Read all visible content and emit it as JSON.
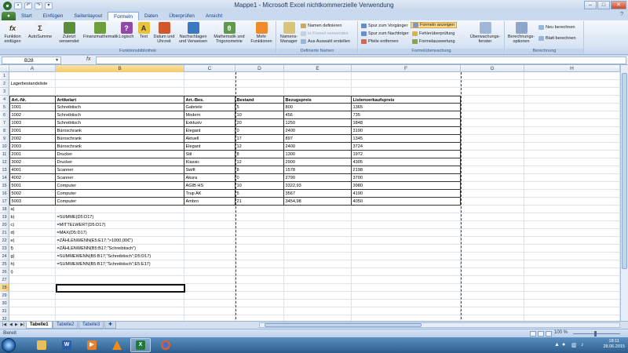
{
  "window": {
    "title": "Mappe1 - Microsoft Excel nichtkommerzielle Verwendung",
    "minimize_icon": "minimize-icon",
    "maximize_icon": "maximize-icon",
    "close_icon": "close-icon"
  },
  "quick_access": [
    "save-icon",
    "undo-icon",
    "redo-icon",
    "customize-icon"
  ],
  "ribbon_tabs": [
    "Start",
    "Einfügen",
    "Seitenlayout",
    "Formeln",
    "Daten",
    "Überprüfen",
    "Ansicht"
  ],
  "active_tab": "Formeln",
  "ribbon": {
    "groups": {
      "funktionsbibliothek": "Funktionsbibliothek",
      "definierte_namen": "Definierte Namen",
      "formelueberwachung": "Formelüberwachung",
      "berechnung": "Berechnung"
    },
    "buttons": {
      "funktion_einfuegen": "Funktion einfügen",
      "autosumme": "AutoSumme",
      "zuletzt_verwendet": "Zuletzt verwendet",
      "finanzmathematik": "Finanzmathematik",
      "logisch": "Logisch",
      "text": "Text",
      "datum_uhrzeit": "Datum und Uhrzeit",
      "nachschlagen": "Nachschlagen und Verweisen",
      "mathematik": "Mathematik und Trigonometrie",
      "mehr_funktionen": "Mehr Funktionen",
      "namens_manager": "Namens-Manager",
      "namen_definieren": "Namen definieren",
      "in_formel_verwenden": "In Formel verwenden",
      "aus_auswahl_erstellen": "Aus Auswahl erstellen",
      "spur_vorgaenger": "Spur zum Vorgänger",
      "spur_nachfolger": "Spur zum Nachfolger",
      "pfeile_entfernen": "Pfeile entfernen",
      "formeln_anzeigen": "Formeln anzeigen",
      "fehlerueberpruefung": "Fehlerüberprüfung",
      "formelauswertung": "Formelauswertung",
      "ueberwachungsfenster": "Überwachungs-fenster",
      "berechnungsoptionen": "Berechnungs-optionen",
      "neu_berechnen": "Neu berechnen",
      "blatt_berechnen": "Blatt berechnen"
    }
  },
  "formula_bar": {
    "name_box": "B28",
    "fx_label": "fx",
    "formula": ""
  },
  "columns": [
    "A",
    "B",
    "C",
    "D",
    "E",
    "F",
    "G",
    "H"
  ],
  "selected_column": "B",
  "selected_row": "28",
  "rows": [
    {
      "n": "1",
      "cells": [
        "",
        "",
        "",
        "",
        "",
        ""
      ]
    },
    {
      "n": "2",
      "cells": [
        "Lagerbestandsliste",
        "",
        "",
        "",
        "",
        ""
      ]
    },
    {
      "n": "3",
      "cells": [
        "",
        "",
        "",
        "",
        "",
        ""
      ]
    },
    {
      "n": "4",
      "cells": [
        "Art.-Nr.",
        "Artikelart",
        "Art.-Bes.",
        "Bestand",
        "Bezugspreis",
        "Listenverkaufspreis"
      ],
      "header": true
    },
    {
      "n": "5",
      "cells": [
        "1001",
        "Schreibtisch",
        "Gabriele",
        "5",
        "800",
        "1365"
      ]
    },
    {
      "n": "6",
      "cells": [
        "1002",
        "Schreibtisch",
        "Modern",
        "10",
        "456",
        "735"
      ]
    },
    {
      "n": "7",
      "cells": [
        "1003",
        "Schreibtisch",
        "Exklusiv",
        "20",
        "1250",
        "1848"
      ]
    },
    {
      "n": "8",
      "cells": [
        "2001",
        "Büroschrank",
        "Elegant",
        "0",
        "2400",
        "3190"
      ]
    },
    {
      "n": "9",
      "cells": [
        "2002",
        "Büroschrank",
        "Aktuell",
        "17",
        "897",
        "1345"
      ]
    },
    {
      "n": "10",
      "cells": [
        "2003",
        "Büroschrank",
        "Elegant",
        "12",
        "2400",
        "3724"
      ]
    },
    {
      "n": "11",
      "cells": [
        "2001",
        "Drucker",
        "Stil",
        "8",
        "1300",
        "1972"
      ]
    },
    {
      "n": "12",
      "cells": [
        "3002",
        "Drucker",
        "Klassic",
        "12",
        "2900",
        "4305"
      ]
    },
    {
      "n": "13",
      "cells": [
        "4001",
        "Scanner",
        "Swift",
        "8",
        "1578",
        "2198"
      ]
    },
    {
      "n": "14",
      "cells": [
        "4002",
        "Scanner",
        "Akura",
        "0",
        "2790",
        "3700"
      ]
    },
    {
      "n": "15",
      "cells": [
        "5001",
        "Computer",
        "AGIB HS",
        "10",
        "3322,93",
        "3980"
      ]
    },
    {
      "n": "16",
      "cells": [
        "5002",
        "Computer",
        "Trup AK",
        "5",
        "3567",
        "4190"
      ]
    },
    {
      "n": "17",
      "cells": [
        "5003",
        "Computer",
        "Ambro",
        "21",
        "3454,98",
        "4050"
      ]
    },
    {
      "n": "18",
      "cells": [
        "a)",
        "",
        "",
        "",
        "",
        ""
      ]
    },
    {
      "n": "19",
      "cells": [
        "b)",
        "=SUMME(D5:D17)",
        "",
        "",
        "",
        ""
      ]
    },
    {
      "n": "20",
      "cells": [
        "c)",
        "=MITTELWERT(D5:D17)",
        "",
        "",
        "",
        ""
      ]
    },
    {
      "n": "21",
      "cells": [
        "d)",
        "=MAX(D5:D17)",
        "",
        "",
        "",
        ""
      ]
    },
    {
      "n": "22",
      "cells": [
        "e)",
        "=ZÄHLENWENN(E5:E17;\">1000,00€\")",
        "",
        "",
        "",
        ""
      ]
    },
    {
      "n": "23",
      "cells": [
        "f)",
        "=ZÄHLENWENN(B5:B17;\"Schreibtisch\")",
        "",
        "",
        "",
        ""
      ]
    },
    {
      "n": "24",
      "cells": [
        "g)",
        "=SUMMEWENN(B5:B17;\"Schreibtisch\";D5:D17)",
        "",
        "",
        "",
        ""
      ]
    },
    {
      "n": "25",
      "cells": [
        "h)",
        "=SUMMEWENN(B5:B17;\"Schreibtisch\";E5:E17)",
        "",
        "",
        "",
        ""
      ]
    },
    {
      "n": "26",
      "cells": [
        "i)",
        "",
        "",
        "",
        "",
        ""
      ]
    },
    {
      "n": "27",
      "cells": [
        "",
        "",
        "",
        "",
        "",
        ""
      ]
    },
    {
      "n": "28",
      "cells": [
        "",
        "",
        "",
        "",
        "",
        ""
      ]
    },
    {
      "n": "29",
      "cells": [
        "",
        "",
        "",
        "",
        "",
        ""
      ]
    },
    {
      "n": "30",
      "cells": [
        "",
        "",
        "",
        "",
        "",
        ""
      ]
    },
    {
      "n": "31",
      "cells": [
        "",
        "",
        "",
        "",
        "",
        ""
      ]
    },
    {
      "n": "32",
      "cells": [
        "",
        "",
        "",
        "",
        "",
        ""
      ]
    }
  ],
  "sheet_tabs": [
    "Tabelle1",
    "Tabelle2",
    "Tabelle3"
  ],
  "active_sheet": "Tabelle1",
  "status": {
    "text": "Bereit",
    "zoom": "100 %"
  },
  "taskbar": {
    "apps": [
      "explorer-icon",
      "word-icon",
      "media-player-icon",
      "vlc-icon",
      "excel-icon",
      "firefox-icon"
    ],
    "time": "18:11",
    "date": "28.06.2015"
  },
  "colors": {
    "ribbon_bg": "#dae6f4",
    "selection_highlight": "#f5c86c",
    "taskbar": "#2c5e8d"
  }
}
